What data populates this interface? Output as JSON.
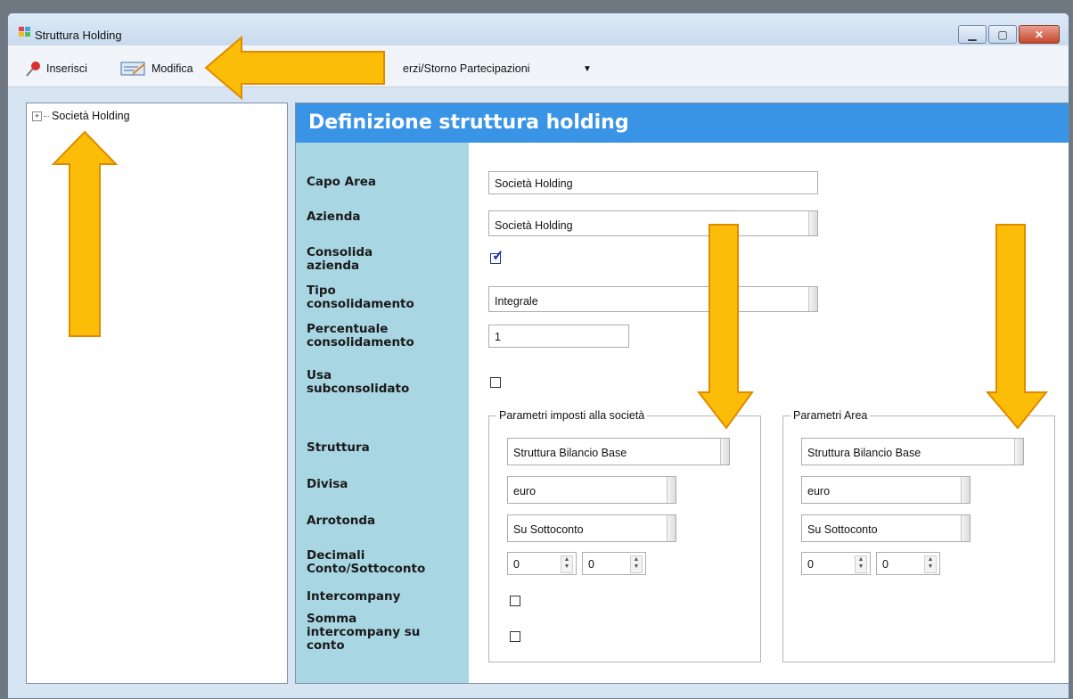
{
  "window": {
    "title": "Struttura Holding",
    "buttons": {
      "minimize": "▁",
      "maximize": "▢",
      "close": "✕"
    }
  },
  "toolbar": {
    "insert_label": "Inserisci",
    "modify_label": "Modifica",
    "third_label": "erzi/Storno Partecipazioni",
    "dropdown_glyph": "▼"
  },
  "tree": {
    "root": {
      "expander": "+",
      "label": "Società Holding"
    }
  },
  "panel": {
    "title": "Definizione struttura holding",
    "labels": {
      "capo_area": "Capo Area",
      "azienda": "Azienda",
      "consolida_azienda": [
        "Consolida",
        "azienda"
      ],
      "tipo_consolidamento": [
        "Tipo",
        "consolidamento"
      ],
      "percentuale_consolidamento": [
        "Percentuale",
        "consolidamento"
      ],
      "usa_subconsolidato": [
        "Usa",
        "subconsolidato"
      ],
      "struttura": "Struttura",
      "divisa": "Divisa",
      "arrotonda": "Arrotonda",
      "decimali": [
        "Decimali",
        "Conto/Sottoconto"
      ],
      "intercompany": "Intercompany",
      "somma_intercompany": [
        "Somma",
        "intercompany su",
        "conto"
      ]
    },
    "values": {
      "capo_area": "Società Holding",
      "azienda": "Società Holding",
      "consolida_azienda_checked": true,
      "tipo_consolidamento": "Integrale",
      "percentuale_consolidamento": "1",
      "usa_subconsolidato_checked": false
    },
    "group_societa": {
      "legend": "Parametri imposti alla società",
      "struttura": "Struttura Bilancio Base",
      "divisa": "euro",
      "arrotonda": "Su Sottoconto",
      "decimali_conto": "0",
      "decimali_sottoconto": "0",
      "intercompany_checked": false,
      "somma_intercompany_checked": false
    },
    "group_area": {
      "legend": "Parametri Area",
      "struttura": "Struttura Bilancio Base",
      "divisa": "euro",
      "arrotonda": "Su Sottoconto",
      "decimali_conto": "0",
      "decimali_sottoconto": "0"
    },
    "check_glyph": "✓"
  },
  "colors": {
    "header_blue": "#3a94e6",
    "label_column": "#a9d6e3",
    "annotation_arrow": "#fbbd08",
    "annotation_arrow_border": "#e08a00"
  },
  "annotations": [
    "arrow-left",
    "arrow-up",
    "arrow-down",
    "arrow-down"
  ]
}
